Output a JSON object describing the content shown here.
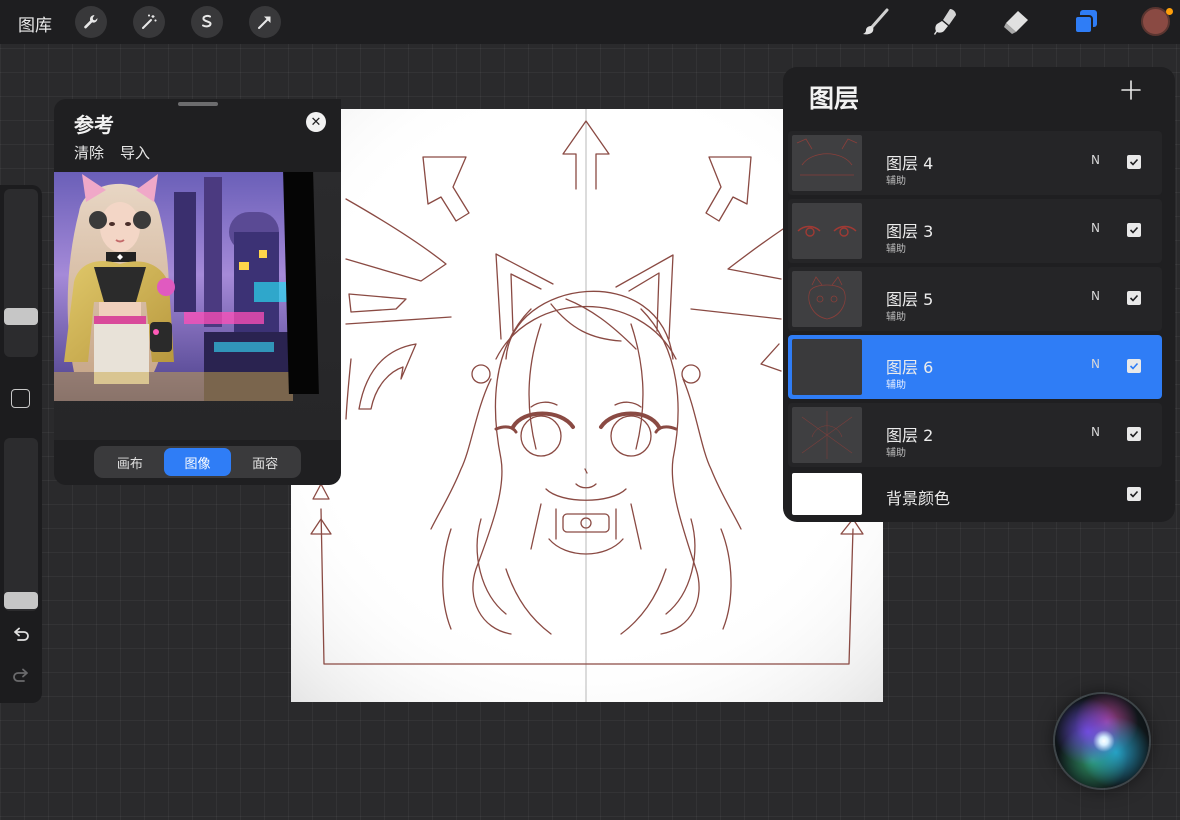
{
  "topbar": {
    "gallery_label": "图库",
    "left_tools": [
      "wrench-icon",
      "magic-wand-icon",
      "selection-icon",
      "transform-arrow-icon"
    ],
    "right_tools": [
      "brush-icon",
      "smudge-icon",
      "eraser-icon",
      "layers-icon"
    ],
    "active_tool": "layers-icon",
    "current_color": "#8a4a43",
    "accent": "#2f7df6"
  },
  "reference": {
    "title": "参考",
    "clear_label": "清除",
    "import_label": "导入",
    "tabs": [
      {
        "label": "画布",
        "active": false
      },
      {
        "label": "图像",
        "active": true
      },
      {
        "label": "面容",
        "active": false
      }
    ]
  },
  "layers": {
    "title": "图层",
    "items": [
      {
        "name": "图层 4",
        "sub": "辅助",
        "mode": "N",
        "visible": true,
        "selected": false
      },
      {
        "name": "图层 3",
        "sub": "辅助",
        "mode": "N",
        "visible": true,
        "selected": false
      },
      {
        "name": "图层 5",
        "sub": "辅助",
        "mode": "N",
        "visible": true,
        "selected": false
      },
      {
        "name": "图层 6",
        "sub": "辅助",
        "mode": "N",
        "visible": true,
        "selected": true
      },
      {
        "name": "图层 2",
        "sub": "辅助",
        "mode": "N",
        "visible": true,
        "selected": false
      }
    ],
    "background": {
      "name": "背景颜色",
      "color": "#ffffff",
      "visible": true
    }
  },
  "sidebar": {
    "brush_size_level": 0.4,
    "opacity_level": 0.97,
    "icons": [
      "modify-button-icon",
      "undo-icon",
      "redo-icon"
    ]
  }
}
